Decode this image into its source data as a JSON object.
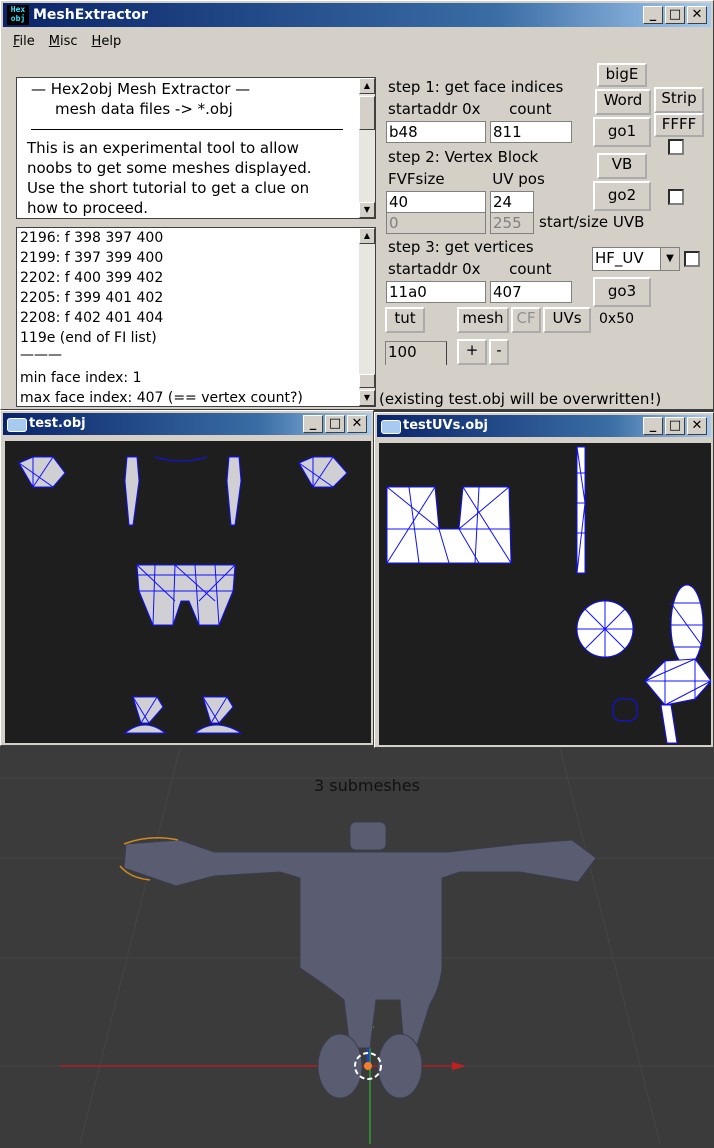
{
  "main_window": {
    "title": "MeshExtractor",
    "icon_text": "Hex obj",
    "menu": [
      "File",
      "Misc",
      "Help"
    ]
  },
  "info": {
    "line1": "—   Hex2obj Mesh Extractor   —",
    "line2": "mesh data files -> *.obj",
    "body": [
      "This is an experimental tool to allow",
      "noobs to get some meshes displayed.",
      "Use the short tutorial to get a clue on",
      "how to proceed."
    ]
  },
  "log": {
    "lines": [
      "2196: f  398 397 400",
      "2199: f  397 399 400",
      "2202: f  400 399 402",
      "2205: f  399 401 402",
      "2208: f  402 401 404",
      "119e (end of FI list)",
      "———",
      "min face index: 1",
      "max face index: 407 (== vertex count?)"
    ]
  },
  "step1": {
    "title": "step 1: get face indices",
    "sub": "startaddr 0x      count",
    "addr": "b48",
    "count": "811"
  },
  "step2": {
    "title": "step 2: Vertex Block",
    "sub": "FVFsize          UV pos",
    "fvf": "40",
    "uvpos": "24",
    "start_dis": "0",
    "size_dis": "255",
    "uvb_label": "start/size UVB"
  },
  "step3": {
    "title": "step 3: get vertices",
    "sub": "startaddr 0x      count",
    "addr": "11a0",
    "count": "407",
    "select": "HF_UV"
  },
  "buttons": {
    "bigE": "bigE",
    "word": "Word",
    "strip": "Strip",
    "ffff": "FFFF",
    "go1": "go1",
    "vb": "VB",
    "go2": "go2",
    "go3": "go3",
    "tut": "tut",
    "mesh": "mesh",
    "cf": "CF",
    "uvs": "UVs",
    "hex50": "0x50",
    "plus": "+",
    "minus": "-"
  },
  "scale_value": "100",
  "status_text": "(existing test.obj will be overwritten!)",
  "viewer1": {
    "title": "test.obj"
  },
  "viewer2": {
    "title": "testUVs.obj"
  },
  "scene_label": "3 submeshes",
  "colors": {
    "title_blue": "#0a246a",
    "wire": "#0000ff",
    "viewport": "#3b3b3b"
  }
}
